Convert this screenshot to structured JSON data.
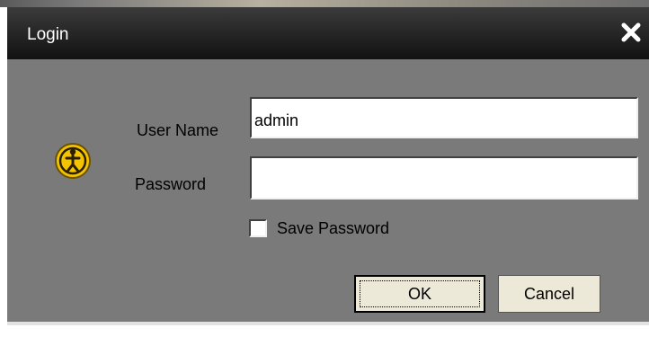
{
  "window": {
    "title": "Login",
    "close_icon": "close-icon"
  },
  "form": {
    "user_icon": "user-icon",
    "username_label": "User Name",
    "username_value": "admin",
    "password_label": "Password",
    "password_value": "",
    "save_password_label": "Save Password",
    "save_password_checked": false
  },
  "buttons": {
    "ok_label": "OK",
    "cancel_label": "Cancel"
  },
  "colors": {
    "dialog_body": "#7a7a7a",
    "titlebar": "#1e1e1e",
    "button_face": "#ece9d8",
    "icon_yellow": "#f5c400"
  }
}
